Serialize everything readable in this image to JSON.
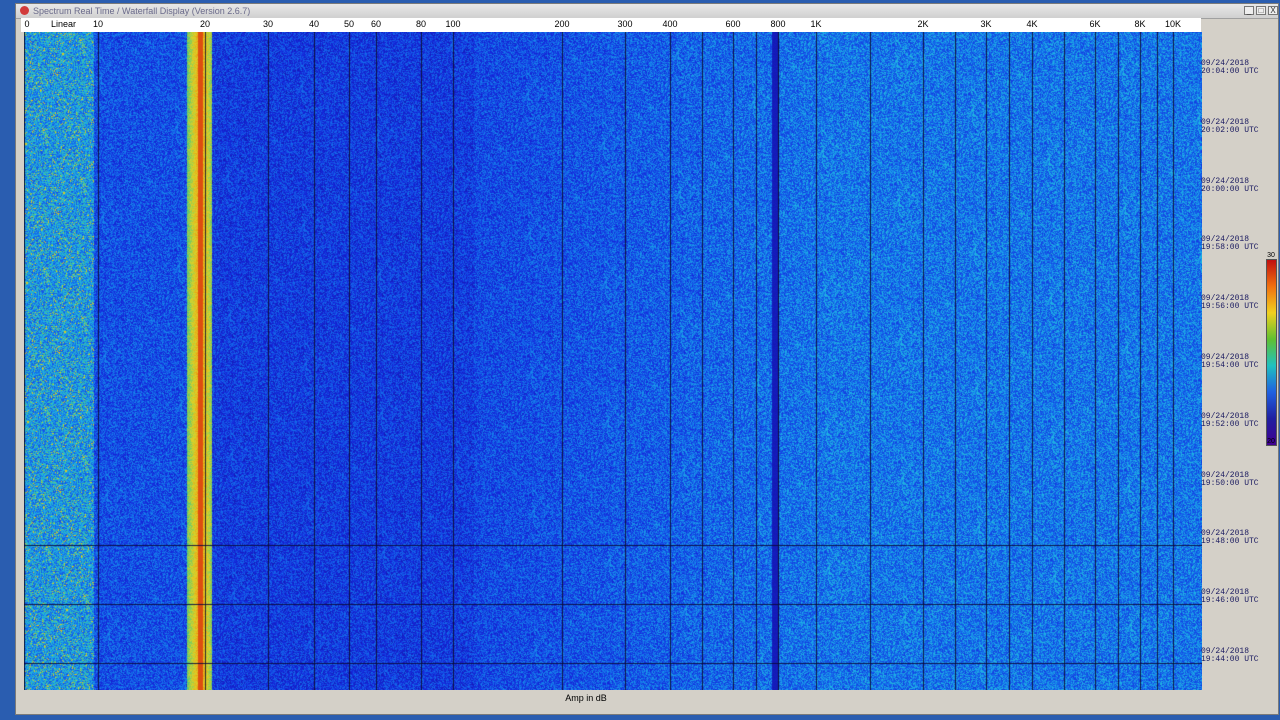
{
  "window": {
    "title": "Spectrum Real Time / Waterfall Display (Version 2.6.7)",
    "buttons": {
      "minimize": "_",
      "maximize": "□",
      "close": "X"
    }
  },
  "freq_axis": {
    "mode_label": "Linear",
    "ticks": [
      {
        "label": "0",
        "hz": 0
      },
      {
        "label": "10",
        "hz": 10
      },
      {
        "label": "20",
        "hz": 20
      },
      {
        "label": "30",
        "hz": 30
      },
      {
        "label": "40",
        "hz": 40
      },
      {
        "label": "50",
        "hz": 50
      },
      {
        "label": "60",
        "hz": 60
      },
      {
        "label": "80",
        "hz": 80
      },
      {
        "label": "100",
        "hz": 100
      },
      {
        "label": "200",
        "hz": 200
      },
      {
        "label": "300",
        "hz": 300
      },
      {
        "label": "400",
        "hz": 400
      },
      {
        "label": "600",
        "hz": 600
      },
      {
        "label": "800",
        "hz": 800
      },
      {
        "label": "1K",
        "hz": 1000
      },
      {
        "label": "2K",
        "hz": 2000
      },
      {
        "label": "3K",
        "hz": 3000
      },
      {
        "label": "4K",
        "hz": 4000
      },
      {
        "label": "6K",
        "hz": 6000
      },
      {
        "label": "8K",
        "hz": 8000
      },
      {
        "label": "10K",
        "hz": 10000
      }
    ]
  },
  "timestamps": [
    {
      "date": "09/24/2018",
      "time": "20:04:00 UTC"
    },
    {
      "date": "09/24/2018",
      "time": "20:02:00 UTC"
    },
    {
      "date": "09/24/2018",
      "time": "20:00:00 UTC"
    },
    {
      "date": "09/24/2018",
      "time": "19:58:00 UTC"
    },
    {
      "date": "09/24/2018",
      "time": "19:56:00 UTC"
    },
    {
      "date": "09/24/2018",
      "time": "19:54:00 UTC"
    },
    {
      "date": "09/24/2018",
      "time": "19:52:00 UTC"
    },
    {
      "date": "09/24/2018",
      "time": "19:50:00 UTC"
    },
    {
      "date": "09/24/2018",
      "time": "19:48:00 UTC"
    },
    {
      "date": "09/24/2018",
      "time": "19:46:00 UTC"
    },
    {
      "date": "09/24/2018",
      "time": "19:44:00 UTC"
    }
  ],
  "colorbar": {
    "max_label": "30",
    "min_label": "20"
  },
  "x_axis_label": "Amp in dB",
  "colors": {
    "background_blue": "#2a5db0",
    "waterfall_low": "#1020c0",
    "waterfall_mid": "#1a80e0",
    "waterfall_high": "#f0a000",
    "waterfall_peak": "#d02010"
  }
}
